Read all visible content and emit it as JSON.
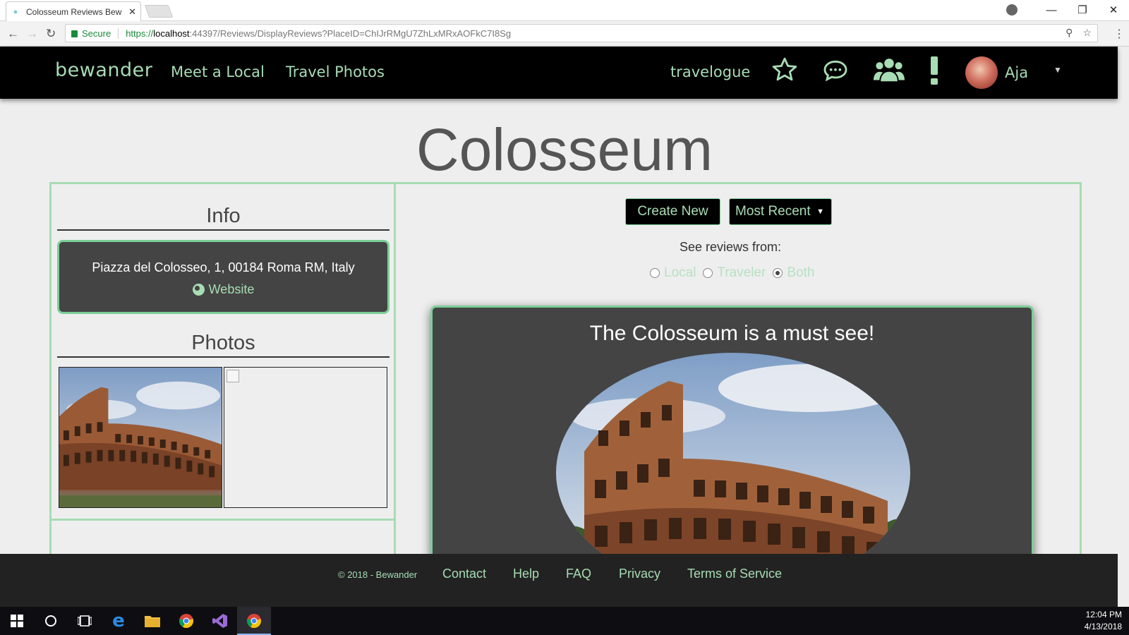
{
  "browser": {
    "tab_title": "Colosseum Reviews Bew",
    "tab_close": "✕",
    "secure_label": "Secure",
    "url_prefix": "https://",
    "url_host": "localhost",
    "url_rest": ":44397/Reviews/DisplayReviews?PlaceID=ChIJrRMgU7ZhLxMRxAOFkC7I8Sg"
  },
  "nav": {
    "brand": "bewander",
    "links": [
      "Meet a Local",
      "Travel Photos",
      "travelogue"
    ],
    "username": "Aja"
  },
  "page": {
    "title": "Colosseum"
  },
  "info": {
    "heading": "Info",
    "address": "Piazza del Colosseo, 1, 00184 Roma RM, Italy",
    "website_label": "Website"
  },
  "photos": {
    "heading": "Photos"
  },
  "controls": {
    "create_label": "Create New",
    "sort_selected": "Most Recent",
    "see_reviews_label": "See reviews from:",
    "filters": [
      {
        "label": "Local",
        "checked": false
      },
      {
        "label": "Traveler",
        "checked": false
      },
      {
        "label": "Both",
        "checked": true
      }
    ]
  },
  "review": {
    "title": "The Colosseum is a must see!"
  },
  "footer": {
    "copyright": "© 2018 - Bewander",
    "links": [
      "Contact",
      "Help",
      "FAQ",
      "Privacy",
      "Terms of Service"
    ]
  },
  "taskbar": {
    "time": "12:04 PM",
    "date": "4/13/2018"
  },
  "colors": {
    "accent": "#a8dcb4",
    "border": "#7bcf98",
    "card": "#444444",
    "nav_bg": "#000000"
  }
}
